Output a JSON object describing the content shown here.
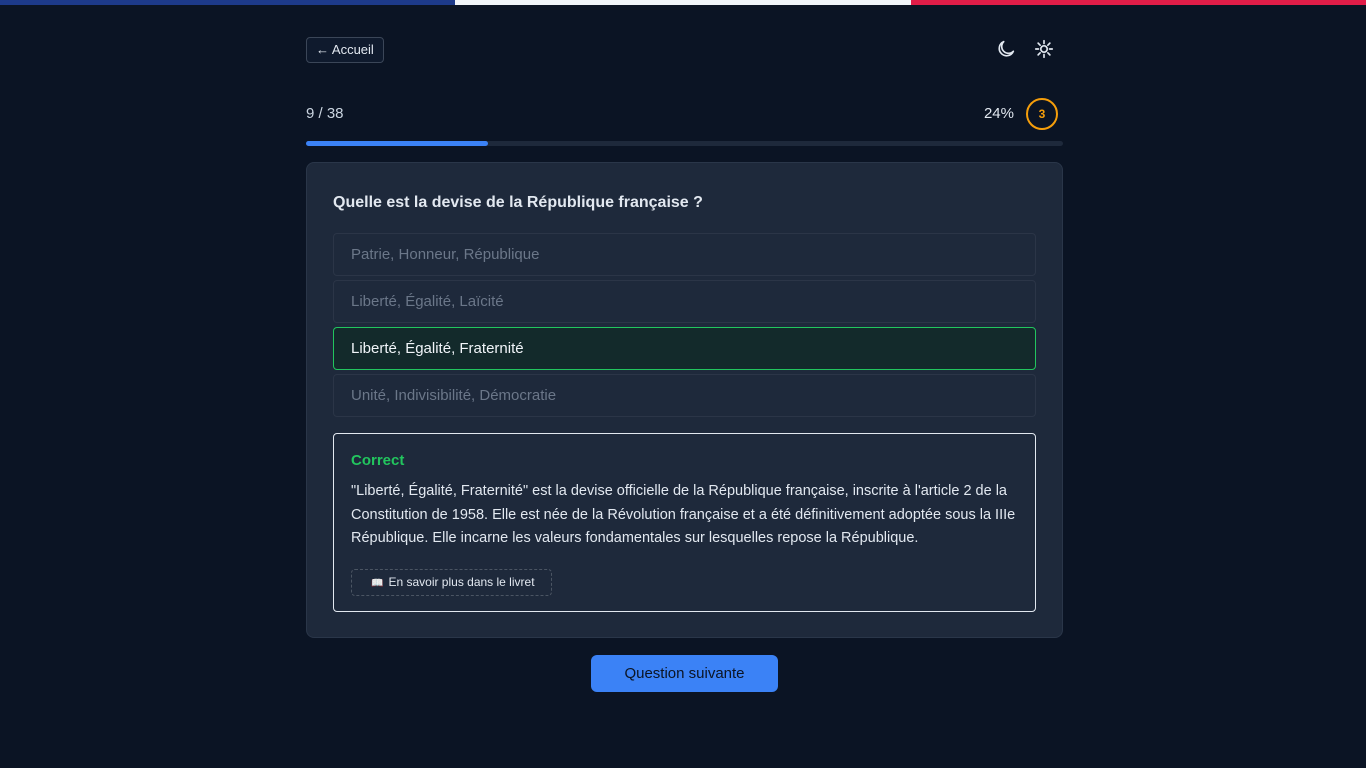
{
  "theme": {
    "flag_colors": [
      "#1d3a8a",
      "#f1f5f9",
      "#e11d48"
    ],
    "accent": "#3b82f6",
    "correct_color": "#22c55e",
    "streak_color": "#f59e0b"
  },
  "header": {
    "back_label": "← Accueil",
    "moon_icon": "moon-icon",
    "sun_icon": "sun-icon"
  },
  "progress": {
    "counter": "9 / 38",
    "percent_label": "24%",
    "fill_fraction": 0.24,
    "streak": "3"
  },
  "quiz": {
    "question": "Quelle est la devise de la République française ?",
    "options": [
      {
        "label": "Patrie, Honneur, République",
        "state": "neutral"
      },
      {
        "label": "Liberté, Égalité, Laïcité",
        "state": "neutral"
      },
      {
        "label": "Liberté, Égalité, Fraternité",
        "state": "correct"
      },
      {
        "label": "Unité, Indivisibilité, Démocratie",
        "state": "neutral"
      }
    ],
    "feedback": {
      "title": "Correct",
      "text": "\"Liberté, Égalité, Fraternité\" est la devise officielle de la République française, inscrite à l'article 2 de la Constitution de 1958. Elle est née de la Révolution française et a été définitivement adoptée sous la IIIe République. Elle incarne les valeurs fondamentales sur lesquelles repose la République.",
      "learn_more_icon": "📖",
      "learn_more_label": "En savoir plus dans le livret"
    },
    "next_label": "Question suivante"
  }
}
